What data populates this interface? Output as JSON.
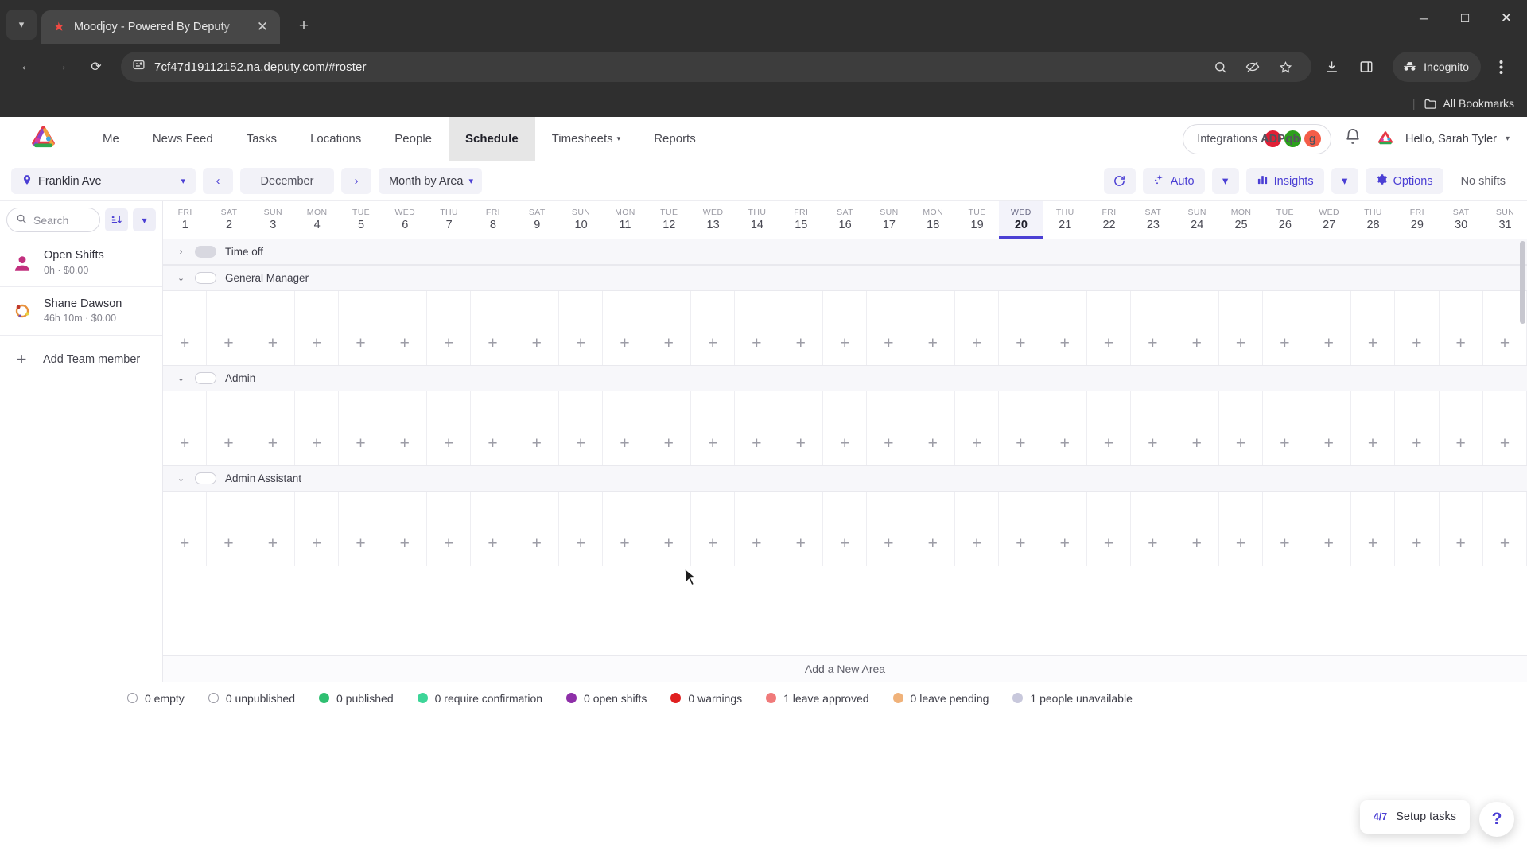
{
  "browser": {
    "tab": {
      "title": "Moodjoy - Powered By Deputy",
      "favicon": "deputy-star-icon",
      "close_label": "✕"
    },
    "new_tab_label": "+",
    "window_controls": {
      "minimize": "─",
      "maximize": "☐",
      "close": "✕"
    },
    "back_label": "←",
    "forward_label": "→",
    "reload_label": "⟳",
    "url": "7cf47d19112152.na.deputy.com/#roster",
    "site_info_icon": "page-info-icon",
    "omnibox_icons": [
      "zoom-icon",
      "tracking-protection-icon",
      "bookmark-star-icon"
    ],
    "download_icon": "download-icon",
    "side_panel_icon": "side-panel-icon",
    "incognito_label": "Incognito",
    "menu_icon": "kebab-menu-icon",
    "bookmarks_label": "All Bookmarks"
  },
  "app": {
    "logo": "deputy-logo",
    "nav": [
      {
        "label": "Me",
        "active": false,
        "caret": false
      },
      {
        "label": "News Feed",
        "active": false,
        "caret": false
      },
      {
        "label": "Tasks",
        "active": false,
        "caret": false
      },
      {
        "label": "Locations",
        "active": false,
        "caret": false
      },
      {
        "label": "People",
        "active": false,
        "caret": false
      },
      {
        "label": "Schedule",
        "active": true,
        "caret": false
      },
      {
        "label": "Timesheets",
        "active": false,
        "caret": true
      },
      {
        "label": "Reports",
        "active": false,
        "caret": false
      }
    ],
    "integrations": {
      "label": "Integrations",
      "badges": [
        {
          "name": "adp-icon",
          "text": "ADP",
          "color": "#e01f35"
        },
        {
          "name": "quickbooks-icon",
          "text": "qb",
          "color": "#2ca01c"
        },
        {
          "name": "gusto-icon",
          "text": "g",
          "color": "#f45d48"
        }
      ]
    },
    "notifications_icon": "bell-icon",
    "user": {
      "greeting": "Hello, Sarah Tyler",
      "avatar": "user-avatar",
      "caret": "▾"
    }
  },
  "toolbar": {
    "location": {
      "label": "Franklin Ave",
      "icon": "location-pin-icon",
      "caret": "▾"
    },
    "prev_label": "‹",
    "period_label": "December",
    "next_label": "›",
    "view_mode": {
      "label": "Month by Area",
      "caret": "▾"
    },
    "refresh_icon": "refresh-icon",
    "auto_label": "Auto",
    "auto_icon": "sparkle-icon",
    "auto_caret": "▾",
    "insights_label": "Insights",
    "insights_icon": "bar-chart-icon",
    "insights_caret": "▾",
    "options_label": "Options",
    "options_icon": "gear-icon",
    "no_shifts_label": "No shifts"
  },
  "sidebar": {
    "search_placeholder": "Search",
    "search_icon": "search-icon",
    "sort_icon": "sort-icon",
    "filter_caret": "▾",
    "people": [
      {
        "name": "Open Shifts",
        "meta": "0h · $0.00",
        "avatar": "open-shifts-avatar"
      },
      {
        "name": "Shane Dawson",
        "meta": "46h 10m · $0.00",
        "avatar": "shane-dawson-avatar"
      }
    ],
    "add_member_label": "Add Team member",
    "add_member_icon": "plus-icon"
  },
  "calendar": {
    "today_index": 19,
    "days": [
      {
        "dow": "FRI",
        "num": "1"
      },
      {
        "dow": "SAT",
        "num": "2"
      },
      {
        "dow": "SUN",
        "num": "3"
      },
      {
        "dow": "MON",
        "num": "4"
      },
      {
        "dow": "TUE",
        "num": "5"
      },
      {
        "dow": "WED",
        "num": "6"
      },
      {
        "dow": "THU",
        "num": "7"
      },
      {
        "dow": "FRI",
        "num": "8"
      },
      {
        "dow": "SAT",
        "num": "9"
      },
      {
        "dow": "SUN",
        "num": "10"
      },
      {
        "dow": "MON",
        "num": "11"
      },
      {
        "dow": "TUE",
        "num": "12"
      },
      {
        "dow": "WED",
        "num": "13"
      },
      {
        "dow": "THU",
        "num": "14"
      },
      {
        "dow": "FRI",
        "num": "15"
      },
      {
        "dow": "SAT",
        "num": "16"
      },
      {
        "dow": "SUN",
        "num": "17"
      },
      {
        "dow": "MON",
        "num": "18"
      },
      {
        "dow": "TUE",
        "num": "19"
      },
      {
        "dow": "WED",
        "num": "20"
      },
      {
        "dow": "THU",
        "num": "21"
      },
      {
        "dow": "FRI",
        "num": "22"
      },
      {
        "dow": "SAT",
        "num": "23"
      },
      {
        "dow": "SUN",
        "num": "24"
      },
      {
        "dow": "MON",
        "num": "25"
      },
      {
        "dow": "TUE",
        "num": "26"
      },
      {
        "dow": "WED",
        "num": "27"
      },
      {
        "dow": "THU",
        "num": "28"
      },
      {
        "dow": "FRI",
        "num": "29"
      },
      {
        "dow": "SAT",
        "num": "30"
      },
      {
        "dow": "SUN",
        "num": "31"
      }
    ],
    "areas": [
      {
        "label": "Time off",
        "expanded": false,
        "swatch_filled": true,
        "chevron": "›",
        "show_body": false
      },
      {
        "label": "General Manager",
        "expanded": true,
        "swatch_filled": false,
        "chevron": "⌄",
        "show_body": true
      },
      {
        "label": "Admin",
        "expanded": true,
        "swatch_filled": false,
        "chevron": "⌄",
        "show_body": true
      },
      {
        "label": "Admin Assistant",
        "expanded": true,
        "swatch_filled": false,
        "chevron": "⌄",
        "show_body": true
      }
    ],
    "slot_add_label": "+",
    "add_area_label": "Add a New Area"
  },
  "floating": {
    "setup_fraction": "4/7",
    "setup_label": "Setup tasks",
    "help_label": "?"
  },
  "statusbar": [
    {
      "label": "0 empty",
      "color": "hollow",
      "name": "status-empty"
    },
    {
      "label": "0 unpublished",
      "color": "hollow",
      "name": "status-unpublished"
    },
    {
      "label": "0 published",
      "color": "#2fbf71",
      "name": "status-published"
    },
    {
      "label": "0 require confirmation",
      "color": "#3dd598",
      "name": "status-require-confirmation"
    },
    {
      "label": "0 open shifts",
      "color": "#8e2fa8",
      "name": "status-open-shifts"
    },
    {
      "label": "0 warnings",
      "color": "#e02020",
      "name": "status-warnings"
    },
    {
      "label": "1 leave approved",
      "color": "#f07a7a",
      "name": "status-leave-approved"
    },
    {
      "label": "0 leave pending",
      "color": "#f0b27a",
      "name": "status-leave-pending"
    },
    {
      "label": "1 people unavailable",
      "color": "#c8c8dc",
      "name": "status-people-unavailable"
    }
  ]
}
